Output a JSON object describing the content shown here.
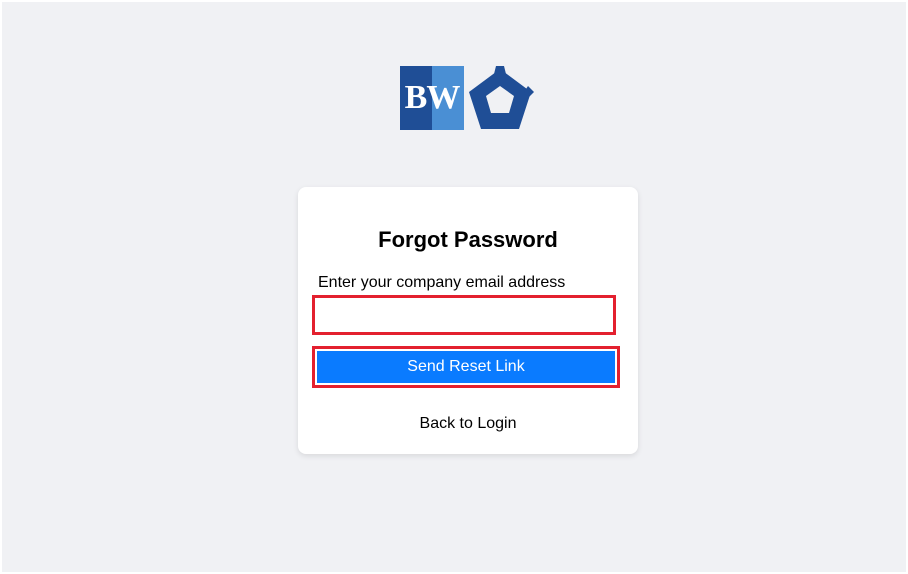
{
  "logo": {
    "text": "BW",
    "icon": "pentagon-ring-icon",
    "colors": {
      "dark_blue": "#1f4e96",
      "light_blue": "#4a8fd4"
    }
  },
  "form": {
    "title": "Forgot Password",
    "email_label": "Enter your company email address",
    "email_value": "",
    "email_placeholder": "",
    "submit_label": "Send Reset Link",
    "back_link": "Back to Login"
  },
  "colors": {
    "page_background": "#f0f1f4",
    "card_background": "#ffffff",
    "button": "#0a7bff",
    "highlight": "#e3202f"
  }
}
